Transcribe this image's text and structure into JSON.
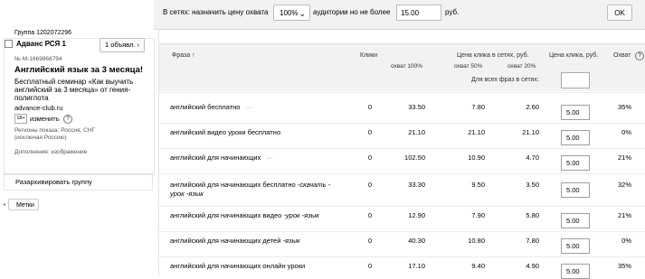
{
  "topbar": {
    "prefix": "В сетях: назначить цену охвата",
    "coverage_selected": "100%",
    "middle": "аудитории но не более",
    "max_price": "15.00",
    "currency": "руб.",
    "ok_label": "OK"
  },
  "adgroup": {
    "group_label": "Группа 1202072296",
    "ad_name": "Адванс РСЯ 1",
    "ads_button": "1 объявл.",
    "ad_number": "№ M-1669868794",
    "ad_title": "Английский язык за 3 месяца!",
    "ad_text": "Бесплатный семинар «Как выучить английский за 3 месяца» от гения-полиглота",
    "ad_url": "advance-club.ru",
    "badge": "18+",
    "change_label": "изменить",
    "regions": "Регионы показа: Россия, СНГ (исключая Россию)",
    "extras": "Дополнения: изображение",
    "unarchive_label": "Разархивировать группу",
    "tags_label": "Метки"
  },
  "table": {
    "headers": {
      "phrase": "Фраза ↑",
      "clicks": "Клики",
      "net_cpc": "Цена клика в сетях, руб.",
      "cov100": "охват 100%",
      "cov50": "охват 50%",
      "cov20": "охват 20%",
      "cpc": "Цена клика, руб.",
      "coverage": "Охват"
    },
    "all_phrases_label": "Для всех фраз в сетях:",
    "rows": [
      {
        "phrase": "английский бесплатно",
        "minus": "",
        "dots": "···",
        "clicks": "0",
        "c100": "33.50",
        "c50": "7.80",
        "c20": "2.60",
        "bid": "5.00",
        "cov": "35%"
      },
      {
        "phrase": "английский видео уроки бесплатно",
        "minus": "",
        "dots": "",
        "clicks": "0",
        "c100": "21.10",
        "c50": "21.10",
        "c20": "21.10",
        "bid": "5.00",
        "cov": "0%"
      },
      {
        "phrase": "английский для начинающих",
        "minus": "",
        "dots": "···",
        "clicks": "0",
        "c100": "102.50",
        "c50": "10.90",
        "c20": "4.70",
        "bid": "5.00",
        "cov": "21%"
      },
      {
        "phrase": "английский для начинающих бесплатно",
        "minus": " -скачать -",
        "phrase2": "урок -язык",
        "dots": "",
        "clicks": "0",
        "c100": "33.30",
        "c50": "9.50",
        "c20": "3.50",
        "bid": "5.00",
        "cov": "32%"
      },
      {
        "phrase": "английский для начинающих видео",
        "minus": " -урок -язык",
        "dots": "",
        "clicks": "0",
        "c100": "12.90",
        "c50": "7.90",
        "c20": "5.80",
        "bid": "5.00",
        "cov": "21%"
      },
      {
        "phrase": "английский для начинающих детей",
        "minus": " -язык",
        "dots": "",
        "clicks": "0",
        "c100": "40.30",
        "c50": "10.80",
        "c20": "7.80",
        "bid": "5.00",
        "cov": "0%"
      },
      {
        "phrase": "английский для начинающих онлайн уроки",
        "minus": "",
        "dots": "",
        "clicks": "0",
        "c100": "17.10",
        "c50": "9.40",
        "c20": "4.90",
        "bid": "5.00",
        "cov": "35%"
      }
    ]
  }
}
